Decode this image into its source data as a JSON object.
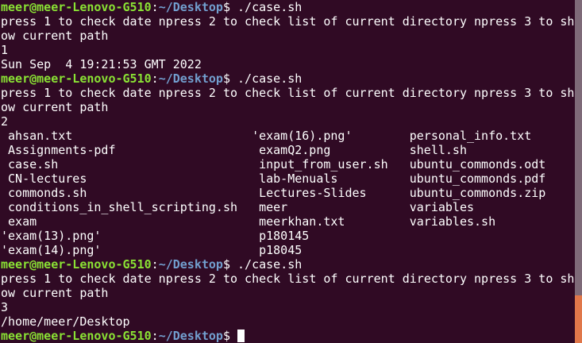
{
  "prompt": {
    "user": "meer@meer-Lenovo-G510",
    "sep": ":",
    "path": "~/Desktop",
    "sign": "$ "
  },
  "colors": {
    "background": "#300a24",
    "user": "#8ae234",
    "path": "#729fcf",
    "scroll_thumb": "#e0774a"
  },
  "scroll_position": 0.86,
  "lines": [
    {
      "type": "prompt",
      "cmd": "./case.sh"
    },
    {
      "type": "text",
      "text": "press 1 to check date npress 2 to check list of current directory npress 3 to sh"
    },
    {
      "type": "text",
      "text": "ow current path"
    },
    {
      "type": "text",
      "text": "1"
    },
    {
      "type": "text",
      "text": "Sun Sep  4 19:21:53 GMT 2022"
    },
    {
      "type": "prompt",
      "cmd": "./case.sh"
    },
    {
      "type": "text",
      "text": "press 1 to check date npress 2 to check list of current directory npress 3 to sh"
    },
    {
      "type": "text",
      "text": "ow current path"
    },
    {
      "type": "text",
      "text": "2"
    },
    {
      "type": "ls",
      "cells": [
        " ahsan.txt",
        "'exam(16).png'",
        "personal_info.txt"
      ]
    },
    {
      "type": "ls",
      "cells": [
        " Assignments-pdf",
        " examQ2.png",
        "shell.sh"
      ]
    },
    {
      "type": "ls",
      "cells": [
        " case.sh",
        " input_from_user.sh",
        "ubuntu_commonds.odt"
      ]
    },
    {
      "type": "ls",
      "cells": [
        " CN-lectures",
        " lab-Menuals",
        "ubuntu_commonds.pdf"
      ]
    },
    {
      "type": "ls",
      "cells": [
        " commonds.sh",
        " Lectures-Slides",
        "ubuntu_commonds.zip"
      ]
    },
    {
      "type": "ls",
      "cells": [
        " conditions_in_shell_scripting.sh",
        " meer",
        "variables"
      ]
    },
    {
      "type": "ls",
      "cells": [
        " exam",
        " meerkhan.txt",
        "variables.sh"
      ]
    },
    {
      "type": "ls",
      "cells": [
        "'exam(13).png'",
        " p180145",
        ""
      ]
    },
    {
      "type": "ls",
      "cells": [
        "'exam(14).png'",
        " p18045",
        ""
      ]
    },
    {
      "type": "prompt",
      "cmd": "./case.sh"
    },
    {
      "type": "text",
      "text": "press 1 to check date npress 2 to check list of current directory npress 3 to sh"
    },
    {
      "type": "text",
      "text": "ow current path"
    },
    {
      "type": "text",
      "text": "3"
    },
    {
      "type": "text",
      "text": "/home/meer/Desktop"
    },
    {
      "type": "prompt",
      "cmd": "",
      "cursor": true
    }
  ]
}
